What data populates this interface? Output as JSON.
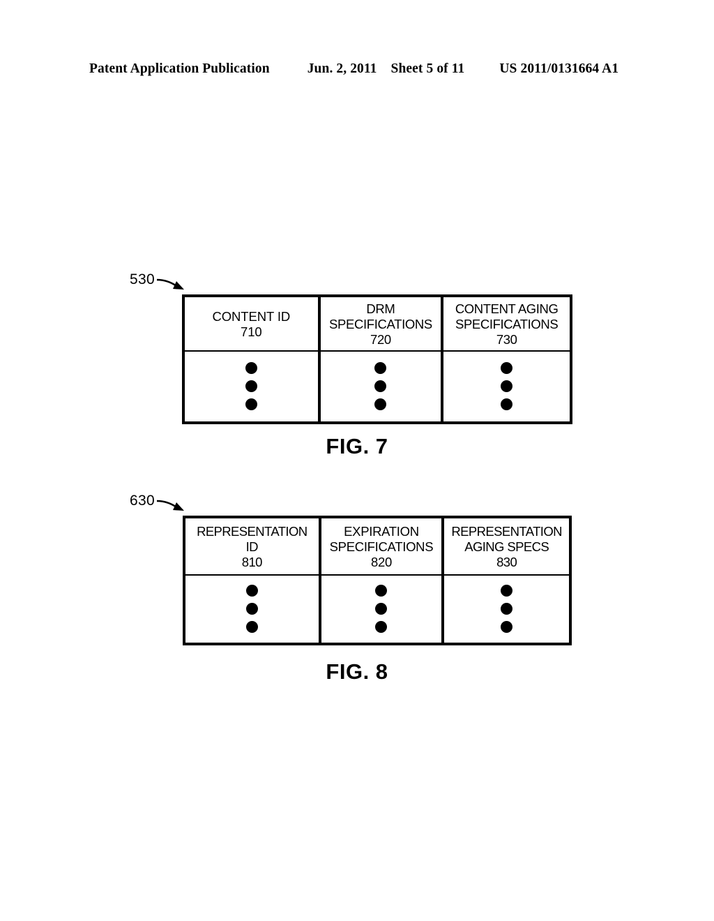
{
  "header": {
    "publication": "Patent Application Publication",
    "date": "Jun. 2, 2011",
    "sheet": "Sheet 5 of 11",
    "patent_number": "US 2011/0131664 A1"
  },
  "figures": [
    {
      "caption": "FIG. 7",
      "reference_numeral": "530",
      "arrow_icon": "callout-arrow-icon",
      "columns": [
        {
          "label": "CONTENT ID",
          "number": "710",
          "dots": 3
        },
        {
          "label": "DRM\nSPECIFICATIONS",
          "label_line1": "DRM",
          "label_line2": "SPECIFICATIONS",
          "number": "720",
          "dots": 3
        },
        {
          "label": "CONTENT AGING\nSPECIFICATIONS",
          "label_line1": "CONTENT AGING",
          "label_line2": "SPECIFICATIONS",
          "number": "730",
          "dots": 3
        }
      ]
    },
    {
      "caption": "FIG. 8",
      "reference_numeral": "630",
      "arrow_icon": "callout-arrow-icon",
      "columns": [
        {
          "label": "REPRESENTATION\nID",
          "label_line1": "REPRESENTATION",
          "label_line2": "ID",
          "number": "810",
          "dots": 3
        },
        {
          "label": "EXPIRATION\nSPECIFICATIONS",
          "label_line1": "EXPIRATION",
          "label_line2": "SPECIFICATIONS",
          "number": "820",
          "dots": 3
        },
        {
          "label": "REPRESENTATION\nAGING SPECS",
          "label_line1": "REPRESENTATION",
          "label_line2": "AGING SPECS",
          "number": "830",
          "dots": 3
        }
      ]
    }
  ],
  "colors": {
    "ink": "#000000",
    "page": "#ffffff"
  }
}
